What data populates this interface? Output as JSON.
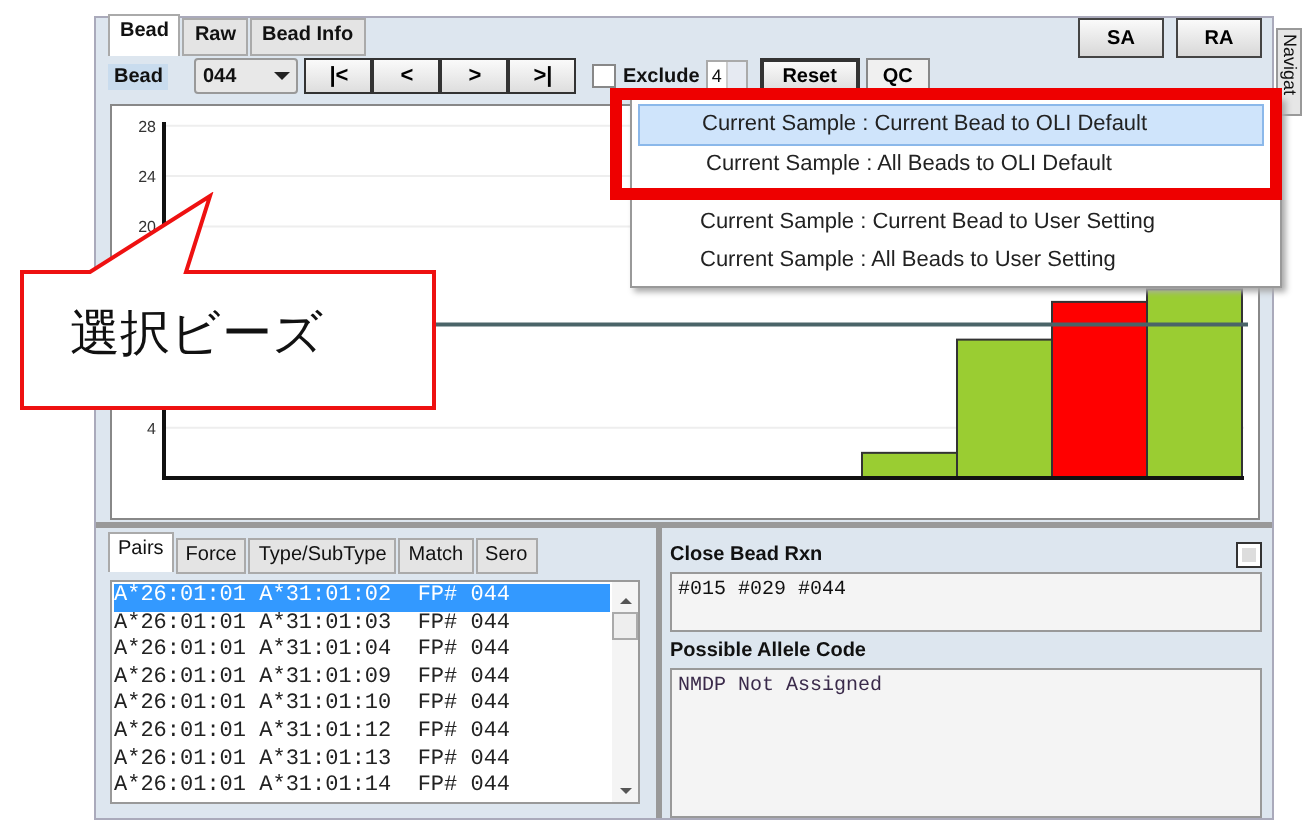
{
  "top_tabs": [
    {
      "label": "Bead",
      "selected": true
    },
    {
      "label": "Raw",
      "selected": false
    },
    {
      "label": "Bead Info",
      "selected": false
    }
  ],
  "top_buttons": [
    "SA",
    "RA"
  ],
  "side_tab": "Navigat",
  "toolbar": {
    "label": "Bead",
    "bead_select": "044",
    "nav_buttons": [
      "|<",
      "<",
      ">",
      ">|"
    ],
    "exclude_checked": false,
    "exclude_label": "Exclude",
    "exclude_value": "4",
    "reset_button": "Reset",
    "qc_button": "QC"
  },
  "chart_data": {
    "type": "bar",
    "stacked": true,
    "grid": true,
    "yticks": [
      4,
      20,
      24,
      28
    ],
    "ylim": [
      0,
      28.3
    ],
    "series": [
      {
        "color": "#9acd32",
        "values": [
          null,
          null,
          null,
          null,
          null,
          null,
          null,
          null,
          2,
          11,
          null,
          15
        ]
      },
      {
        "color": "#ff0000",
        "values": [
          null,
          null,
          null,
          null,
          null,
          null,
          null,
          null,
          null,
          null,
          14,
          null
        ]
      }
    ],
    "ref_lines": [
      {
        "axis": "y",
        "value": 12.2
      }
    ]
  },
  "menu": {
    "items": [
      {
        "label": "Current Sample : Current Bead to OLI Default",
        "selected": true,
        "highlighted": true
      },
      {
        "label": "Current Sample : All Beads to  OLI Default",
        "selected": false,
        "highlighted": true
      },
      {
        "label": "Current Sample : Current Bead to User Setting",
        "selected": false,
        "highlighted": false
      },
      {
        "label": "Current Sample : All Beads to  User Setting",
        "selected": false,
        "highlighted": false
      }
    ]
  },
  "callout": {
    "text": "選択ビーズ"
  },
  "bottom_tabs": [
    {
      "label": "Pairs",
      "selected": true
    },
    {
      "label": "Force",
      "selected": false
    },
    {
      "label": "Type/SubType",
      "selected": false
    },
    {
      "label": "Match",
      "selected": false
    },
    {
      "label": "Sero",
      "selected": false
    }
  ],
  "pairs": [
    {
      "text": "A*26:01:01 A*31:01:02  FP# 044",
      "selected": true
    },
    {
      "text": "A*26:01:01 A*31:01:03  FP# 044",
      "selected": false
    },
    {
      "text": "A*26:01:01 A*31:01:04  FP# 044",
      "selected": false
    },
    {
      "text": "A*26:01:01 A*31:01:09  FP# 044",
      "selected": false
    },
    {
      "text": "A*26:01:01 A*31:01:10  FP# 044",
      "selected": false
    },
    {
      "text": "A*26:01:01 A*31:01:12  FP# 044",
      "selected": false
    },
    {
      "text": "A*26:01:01 A*31:01:13  FP# 044",
      "selected": false
    },
    {
      "text": "A*26:01:01 A*31:01:14  FP# 044",
      "selected": false
    }
  ],
  "close_bead": {
    "title": "Close Bead Rxn",
    "value": "#015 #029 #044"
  },
  "allele_code": {
    "title": "Possible Allele Code",
    "value": "NMDP Not Assigned"
  }
}
